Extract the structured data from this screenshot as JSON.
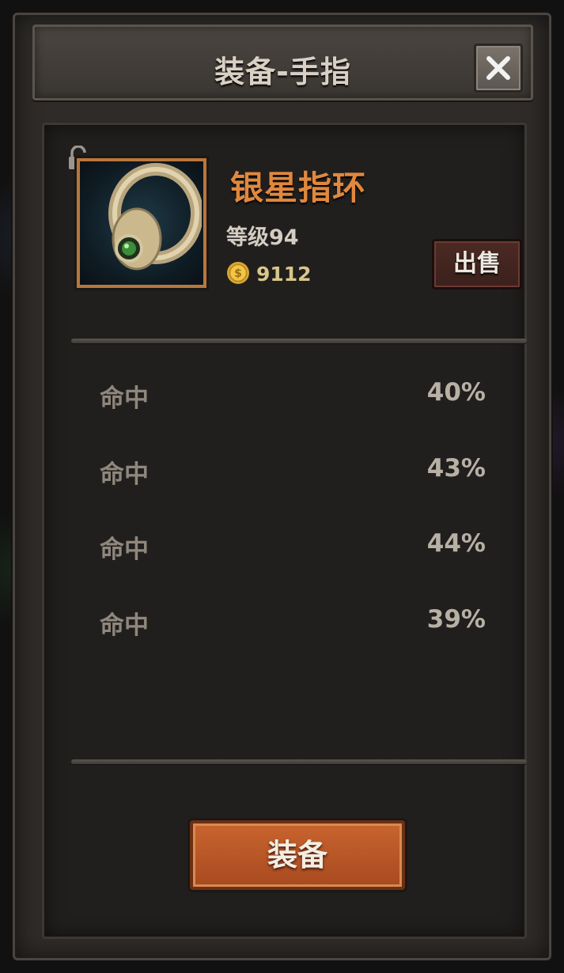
{
  "dialog": {
    "title": "装备-手指",
    "close_icon": "close-icon"
  },
  "item": {
    "name": "银星指环",
    "level": "等级94",
    "price": "9112",
    "image_icon": "ring-icon",
    "lock_icon": "unlocked-padlock-icon",
    "coin_icon": "gold-coin-icon",
    "name_color": "#e0883e"
  },
  "actions": {
    "sell_label": "出售",
    "equip_label": "装备"
  },
  "stats": [
    {
      "name": "命中",
      "value": "40%"
    },
    {
      "name": "命中",
      "value": "43%"
    },
    {
      "name": "命中",
      "value": "44%"
    },
    {
      "name": "命中",
      "value": "39%"
    }
  ]
}
